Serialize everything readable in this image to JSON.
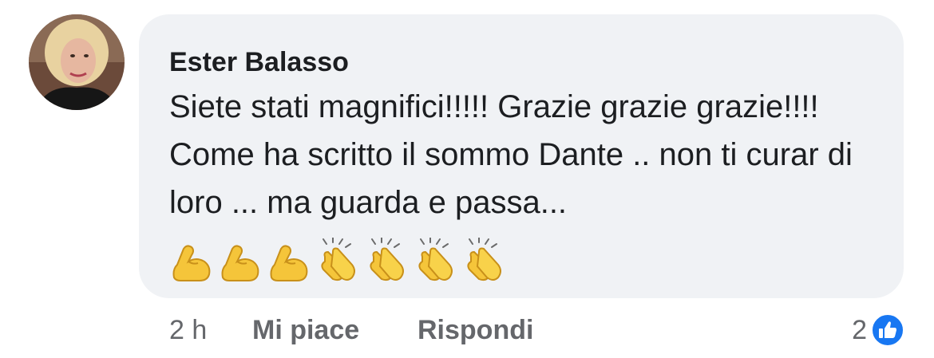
{
  "comment": {
    "author": "Ester Balasso",
    "text": "Siete stati magnifici!!!!! Grazie grazie grazie!!!! Come ha scritto il sommo Dante .. non ti curar di loro ... ma guarda e passa...",
    "emojis": [
      "flexed-biceps",
      "flexed-biceps",
      "flexed-biceps",
      "clapping-hands",
      "clapping-hands",
      "clapping-hands",
      "clapping-hands"
    ]
  },
  "footer": {
    "time": "2 h",
    "like_label": "Mi piace",
    "reply_label": "Rispondi",
    "reaction_count": "2",
    "reaction_icon": "like-thumbs-up-icon"
  },
  "colors": {
    "bubble": "#f0f2f5",
    "text": "#1c1e21",
    "meta": "#65676b",
    "like_blue": "#1877f2"
  }
}
